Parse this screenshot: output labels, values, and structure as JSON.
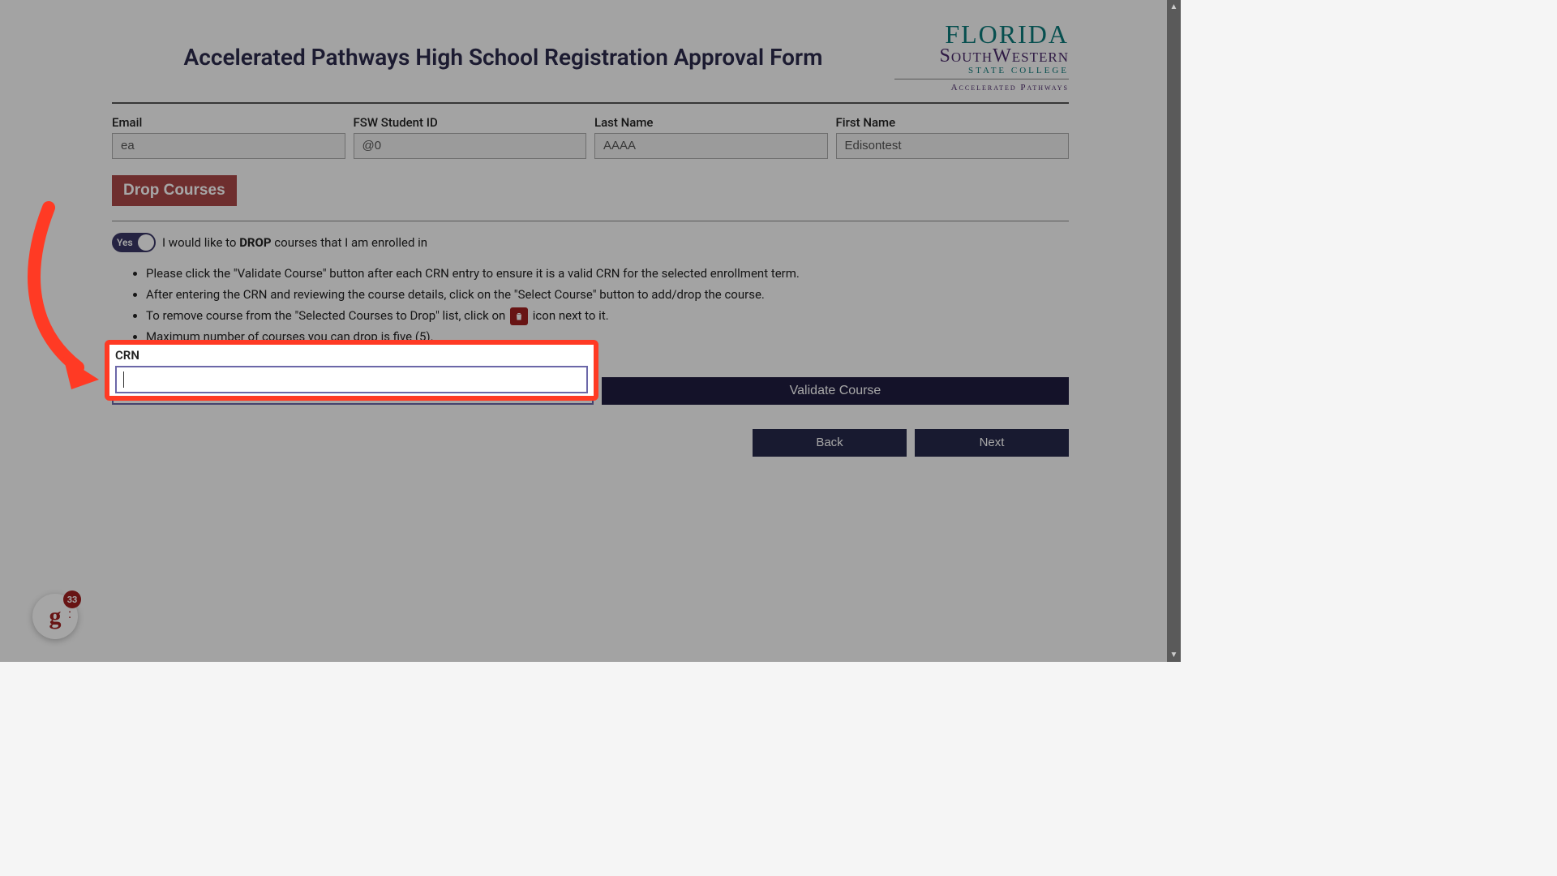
{
  "header": {
    "title": "Accelerated Pathways High School Registration Approval Form",
    "logo": {
      "line1": "FLORIDA",
      "line2": "SouthWestern",
      "line3": "STATE COLLEGE",
      "line4": "Accelerated Pathways"
    }
  },
  "fields": {
    "email": {
      "label": "Email",
      "value": "ea"
    },
    "student_id": {
      "label": "FSW Student ID",
      "value": "@0"
    },
    "last_name": {
      "label": "Last Name",
      "value": "AAAA"
    },
    "first_name": {
      "label": "First Name",
      "value": "Edisontest"
    }
  },
  "drop_button": "Drop Courses",
  "toggle": {
    "state_text": "Yes",
    "value": true,
    "text_prefix": "I would like to ",
    "text_bold": "DROP",
    "text_suffix": " courses that I am enrolled in"
  },
  "instructions": [
    "Please click the \"Validate Course\" button after each CRN entry to ensure it is a valid CRN for the selected enrollment term.",
    "After entering the CRN and reviewing the course details, click on the \"Select Course\" button to add/drop the course.",
    {
      "pre": "To remove course from the \"Selected Courses to Drop\" list, click on ",
      "post": " icon next to it."
    },
    "Maximum number of courses you can drop is five (5)."
  ],
  "crn": {
    "label": "CRN",
    "value": ""
  },
  "buttons": {
    "validate": "Validate Course",
    "back": "Back",
    "next": "Next"
  },
  "widget": {
    "badge": "33"
  }
}
